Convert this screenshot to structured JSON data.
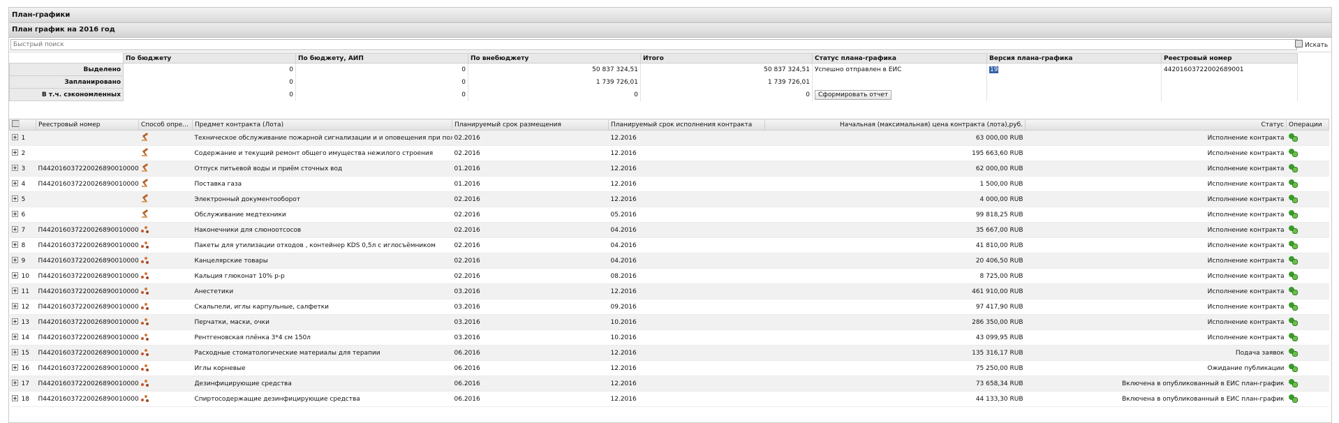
{
  "window": {
    "title": "План-графики",
    "subtitle": "План график на 2016 год"
  },
  "search": {
    "placeholder": "Быстрый поиск",
    "button_label": "Искать"
  },
  "summary": {
    "headers": [
      "По бюджету",
      "По бюджету, АИП",
      "По внебюджету",
      "Итого",
      "Статус плана-графика",
      "Версия плана-графика",
      "Реестровый номер"
    ],
    "rows": [
      {
        "label": "Выделено",
        "budget": "0",
        "aip": "0",
        "extra": "50 837 324,51",
        "total": "50 837 324,51",
        "status": "Успешно отправлен в ЕИС",
        "version": "19",
        "reg": "44201603722002689001"
      },
      {
        "label": "Запланировано",
        "budget": "0",
        "aip": "0",
        "extra": "1 739 726,01",
        "total": "1 739 726,01"
      },
      {
        "label": "В т.ч. сэкономленных",
        "budget": "0",
        "aip": "0",
        "extra": "0",
        "total": "0"
      }
    ],
    "report_button": "Сформировать отчет"
  },
  "grid": {
    "headers": {
      "reg": "Реестровый номер",
      "method": "Способ опре...",
      "subject": "Предмет контракта (Лота)",
      "placement": "Планируемый срок размещения",
      "execution": "Планируемый срок исполнения контракта",
      "price": "Начальная (максимальная) цена контракта (лота),руб.",
      "status": "Статус",
      "ops": "Операции"
    },
    "rows": [
      {
        "n": "1",
        "reg": "",
        "method": "gavel-icon",
        "subject": "Техническое обслуживание пожарной сигнализации и и оповещения при пожаре",
        "placement": "02.2016",
        "execution": "12.2016",
        "price": "63 000,00 RUB",
        "status": "Исполнение контракта"
      },
      {
        "n": "2",
        "reg": "",
        "method": "gavel-icon",
        "subject": "Содержание и текущий ремонт общего имущества нежилого строения",
        "placement": "02.2016",
        "execution": "12.2016",
        "price": "195 663,60 RUB",
        "status": "Исполнение контракта"
      },
      {
        "n": "3",
        "reg": "П44201603722002689001000002",
        "method": "gavel-icon",
        "subject": "Отпуск питьевой воды и приём сточных вод",
        "placement": "01.2016",
        "execution": "12.2016",
        "price": "62 000,00 RUB",
        "status": "Исполнение контракта"
      },
      {
        "n": "4",
        "reg": "П44201603722002689001000001",
        "method": "gavel-icon",
        "subject": "Поставка газа",
        "placement": "01.2016",
        "execution": "12.2016",
        "price": "1 500,00 RUB",
        "status": "Исполнение контракта"
      },
      {
        "n": "5",
        "reg": "",
        "method": "gavel-icon",
        "subject": "Электронный документооборот",
        "placement": "02.2016",
        "execution": "12.2016",
        "price": "4 000,00 RUB",
        "status": "Исполнение контракта"
      },
      {
        "n": "6",
        "reg": "",
        "method": "gavel-icon",
        "subject": "Обслуживание медтехники",
        "placement": "02.2016",
        "execution": "05.2016",
        "price": "99 818,25 RUB",
        "status": "Исполнение контракта"
      },
      {
        "n": "7",
        "reg": "П44201603722002689001000003",
        "method": "auction-icon",
        "subject": "Наконечники для слюноотсосов",
        "placement": "02.2016",
        "execution": "04.2016",
        "price": "35 667,00 RUB",
        "status": "Исполнение контракта"
      },
      {
        "n": "8",
        "reg": "П44201603722002689001000005",
        "method": "auction-icon",
        "subject": "Пакеты для утилизации отходов , контейнер KDS 0,5л с иглосъёмником",
        "placement": "02.2016",
        "execution": "04.2016",
        "price": "41 810,00 RUB",
        "status": "Исполнение контракта"
      },
      {
        "n": "9",
        "reg": "П44201603722002689001000004",
        "method": "auction-icon",
        "subject": "Канцелярские товары",
        "placement": "02.2016",
        "execution": "04.2016",
        "price": "20 406,50 RUB",
        "status": "Исполнение контракта"
      },
      {
        "n": "10",
        "reg": "П44201603722002689001000006",
        "method": "auction-icon",
        "subject": "Кальция глюконат 10% р-р",
        "placement": "02.2016",
        "execution": "08.2016",
        "price": "8 725,00 RUB",
        "status": "Исполнение контракта"
      },
      {
        "n": "11",
        "reg": "П44201603722002689001000007",
        "method": "auction-icon",
        "subject": "Анестетики",
        "placement": "03.2016",
        "execution": "12.2016",
        "price": "461 910,00 RUB",
        "status": "Исполнение контракта"
      },
      {
        "n": "12",
        "reg": "П44201603722002689001000008",
        "method": "auction-icon",
        "subject": "Скальпели, иглы карпульные, салфетки",
        "placement": "03.2016",
        "execution": "09.2016",
        "price": "97 417,90 RUB",
        "status": "Исполнение контракта"
      },
      {
        "n": "13",
        "reg": "П44201603722002689001000009",
        "method": "auction-icon",
        "subject": "Перчатки, маски, очки",
        "placement": "03.2016",
        "execution": "10.2016",
        "price": "286 350,00 RUB",
        "status": "Исполнение контракта"
      },
      {
        "n": "14",
        "reg": "П44201603722002689001000010",
        "method": "auction-icon",
        "subject": "Рентгеновская плёнка 3*4 см 150л",
        "placement": "03.2016",
        "execution": "10.2016",
        "price": "43 099,95 RUB",
        "status": "Исполнение контракта"
      },
      {
        "n": "15",
        "reg": "П44201603722002689001000011",
        "method": "auction-icon",
        "subject": "Расходные стоматологические материалы для терапии",
        "placement": "06.2016",
        "execution": "12.2016",
        "price": "135 316,17 RUB",
        "status": "Подача заявок"
      },
      {
        "n": "16",
        "reg": "П44201603722002689001000012",
        "method": "auction-icon",
        "subject": "Иглы корневые",
        "placement": "06.2016",
        "execution": "12.2016",
        "price": "75 250,00 RUB",
        "status": "Ожидание публикации"
      },
      {
        "n": "17",
        "reg": "П44201603722002689001000013",
        "method": "auction-icon",
        "subject": "Дезинфицирующие средства",
        "placement": "06.2016",
        "execution": "12.2016",
        "price": "73 658,34 RUB",
        "status": "Включена в опубликованный в ЕИС план-график"
      },
      {
        "n": "18",
        "reg": "П44201603722002689001000014",
        "method": "auction-icon",
        "subject": "Спиртосодержащие дезинфицирующие средства",
        "placement": "06.2016",
        "execution": "12.2016",
        "price": "44 133,30 RUB",
        "status": "Включена в опубликованный в ЕИС план-график"
      }
    ]
  }
}
